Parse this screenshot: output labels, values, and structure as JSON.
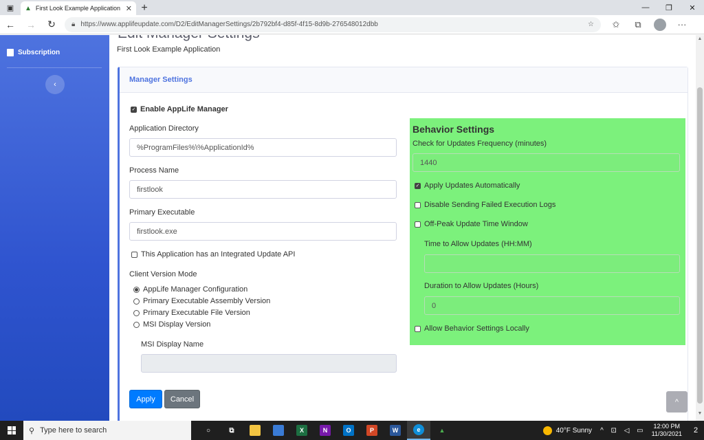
{
  "browser": {
    "tab_title": "First Look Example Application M",
    "url": "https://www.applifeupdate.com/D2/EditManagerSettings/2b792bf4-d85f-4f15-8d9b-276548012dbb"
  },
  "sidebar": {
    "items": [
      {
        "label": "Subscription"
      }
    ]
  },
  "page": {
    "title": "Edit Manager Settings",
    "subtitle": "First Look Example Application"
  },
  "card": {
    "header": "Manager Settings",
    "enable_label": "Enable AppLife Manager",
    "app_dir": {
      "label": "Application Directory",
      "value": "%ProgramFiles%\\%ApplicationId%"
    },
    "process": {
      "label": "Process Name",
      "value": "firstlook"
    },
    "primary_exe": {
      "label": "Primary Executable",
      "value": "firstlook.exe"
    },
    "integrated_api_label": "This Application has an Integrated Update API",
    "client_version_mode": {
      "label": "Client Version Mode",
      "options": [
        "AppLife Manager Configuration",
        "Primary Executable Assembly Version",
        "Primary Executable File Version",
        "MSI Display Version"
      ],
      "selected": "AppLife Manager Configuration"
    },
    "msi_display_name": {
      "label": "MSI Display Name",
      "value": ""
    },
    "apply_label": "Apply",
    "cancel_label": "Cancel"
  },
  "behavior": {
    "title": "Behavior Settings",
    "frequency": {
      "label": "Check for Updates Frequency (minutes)",
      "value": "1440"
    },
    "apply_auto_label": "Apply Updates Automatically",
    "disable_logs_label": "Disable Sending Failed Execution Logs",
    "offpeak_label": "Off-Peak Update Time Window",
    "time_allow": {
      "label": "Time to Allow Updates (HH:MM)",
      "value": ""
    },
    "duration": {
      "label": "Duration to Allow Updates (Hours)",
      "value": "0"
    },
    "allow_local_label": "Allow Behavior Settings Locally"
  },
  "taskbar": {
    "search_placeholder": "Type here to search",
    "weather": "40°F  Sunny",
    "time": "12:00 PM",
    "date": "11/30/2021",
    "notifications": "2"
  },
  "colors": {
    "sidebar": "#4e73df",
    "behavior_bg": "#7cf17c",
    "primary": "#007bff",
    "secondary": "#6c757d"
  }
}
